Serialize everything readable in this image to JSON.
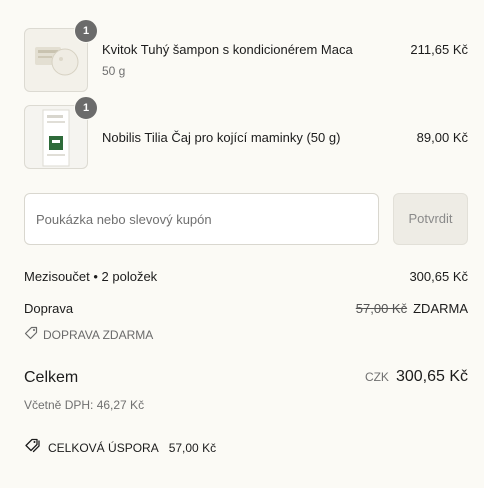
{
  "items": [
    {
      "quantity": "1",
      "name": "Kvitok Tuhý šampon s kondicionérem Maca",
      "variant": "50 g",
      "price": "211,65 Kč"
    },
    {
      "quantity": "1",
      "name": "Nobilis Tilia Čaj pro kojící maminky (50 g)",
      "variant": "",
      "price": "89,00 Kč"
    }
  ],
  "coupon": {
    "placeholder": "Poukázka nebo slevový kupón",
    "apply_label": "Potvrdit"
  },
  "summary": {
    "subtotal_label": "Mezisoučet • 2 položek",
    "subtotal_value": "300,65 Kč",
    "shipping_label": "Doprava",
    "shipping_original": "57,00 Kč",
    "shipping_value": "ZDARMA",
    "shipping_discount_label": "DOPRAVA ZDARMA",
    "total_label": "Celkem",
    "currency": "CZK",
    "total_value": "300,65 Kč",
    "vat_note": "Včetně DPH: 46,27 Kč",
    "savings_label": "CELKOVÁ ÚSPORA",
    "savings_value": "57,00 Kč"
  },
  "icons": {
    "tag": "tag-icon",
    "tags": "tags-icon"
  },
  "colors": {
    "background": "#fbfaf5",
    "badge": "#6b6b6b",
    "muted_text": "#707070",
    "tea_package_green": "#2e6b3a"
  }
}
